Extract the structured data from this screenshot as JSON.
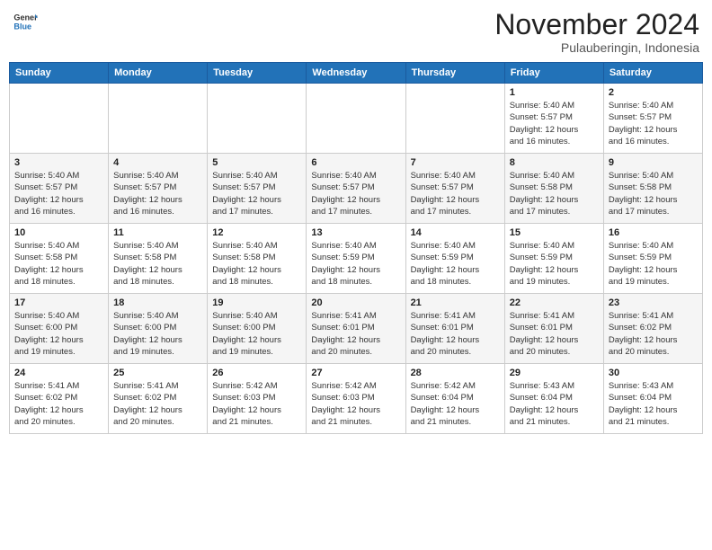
{
  "header": {
    "logo_general": "General",
    "logo_blue": "Blue",
    "month": "November 2024",
    "location": "Pulauberingin, Indonesia"
  },
  "weekdays": [
    "Sunday",
    "Monday",
    "Tuesday",
    "Wednesday",
    "Thursday",
    "Friday",
    "Saturday"
  ],
  "weeks": [
    [
      {
        "day": "",
        "info": ""
      },
      {
        "day": "",
        "info": ""
      },
      {
        "day": "",
        "info": ""
      },
      {
        "day": "",
        "info": ""
      },
      {
        "day": "",
        "info": ""
      },
      {
        "day": "1",
        "info": "Sunrise: 5:40 AM\nSunset: 5:57 PM\nDaylight: 12 hours\nand 16 minutes."
      },
      {
        "day": "2",
        "info": "Sunrise: 5:40 AM\nSunset: 5:57 PM\nDaylight: 12 hours\nand 16 minutes."
      }
    ],
    [
      {
        "day": "3",
        "info": "Sunrise: 5:40 AM\nSunset: 5:57 PM\nDaylight: 12 hours\nand 16 minutes."
      },
      {
        "day": "4",
        "info": "Sunrise: 5:40 AM\nSunset: 5:57 PM\nDaylight: 12 hours\nand 16 minutes."
      },
      {
        "day": "5",
        "info": "Sunrise: 5:40 AM\nSunset: 5:57 PM\nDaylight: 12 hours\nand 17 minutes."
      },
      {
        "day": "6",
        "info": "Sunrise: 5:40 AM\nSunset: 5:57 PM\nDaylight: 12 hours\nand 17 minutes."
      },
      {
        "day": "7",
        "info": "Sunrise: 5:40 AM\nSunset: 5:57 PM\nDaylight: 12 hours\nand 17 minutes."
      },
      {
        "day": "8",
        "info": "Sunrise: 5:40 AM\nSunset: 5:58 PM\nDaylight: 12 hours\nand 17 minutes."
      },
      {
        "day": "9",
        "info": "Sunrise: 5:40 AM\nSunset: 5:58 PM\nDaylight: 12 hours\nand 17 minutes."
      }
    ],
    [
      {
        "day": "10",
        "info": "Sunrise: 5:40 AM\nSunset: 5:58 PM\nDaylight: 12 hours\nand 18 minutes."
      },
      {
        "day": "11",
        "info": "Sunrise: 5:40 AM\nSunset: 5:58 PM\nDaylight: 12 hours\nand 18 minutes."
      },
      {
        "day": "12",
        "info": "Sunrise: 5:40 AM\nSunset: 5:58 PM\nDaylight: 12 hours\nand 18 minutes."
      },
      {
        "day": "13",
        "info": "Sunrise: 5:40 AM\nSunset: 5:59 PM\nDaylight: 12 hours\nand 18 minutes."
      },
      {
        "day": "14",
        "info": "Sunrise: 5:40 AM\nSunset: 5:59 PM\nDaylight: 12 hours\nand 18 minutes."
      },
      {
        "day": "15",
        "info": "Sunrise: 5:40 AM\nSunset: 5:59 PM\nDaylight: 12 hours\nand 19 minutes."
      },
      {
        "day": "16",
        "info": "Sunrise: 5:40 AM\nSunset: 5:59 PM\nDaylight: 12 hours\nand 19 minutes."
      }
    ],
    [
      {
        "day": "17",
        "info": "Sunrise: 5:40 AM\nSunset: 6:00 PM\nDaylight: 12 hours\nand 19 minutes."
      },
      {
        "day": "18",
        "info": "Sunrise: 5:40 AM\nSunset: 6:00 PM\nDaylight: 12 hours\nand 19 minutes."
      },
      {
        "day": "19",
        "info": "Sunrise: 5:40 AM\nSunset: 6:00 PM\nDaylight: 12 hours\nand 19 minutes."
      },
      {
        "day": "20",
        "info": "Sunrise: 5:41 AM\nSunset: 6:01 PM\nDaylight: 12 hours\nand 20 minutes."
      },
      {
        "day": "21",
        "info": "Sunrise: 5:41 AM\nSunset: 6:01 PM\nDaylight: 12 hours\nand 20 minutes."
      },
      {
        "day": "22",
        "info": "Sunrise: 5:41 AM\nSunset: 6:01 PM\nDaylight: 12 hours\nand 20 minutes."
      },
      {
        "day": "23",
        "info": "Sunrise: 5:41 AM\nSunset: 6:02 PM\nDaylight: 12 hours\nand 20 minutes."
      }
    ],
    [
      {
        "day": "24",
        "info": "Sunrise: 5:41 AM\nSunset: 6:02 PM\nDaylight: 12 hours\nand 20 minutes."
      },
      {
        "day": "25",
        "info": "Sunrise: 5:41 AM\nSunset: 6:02 PM\nDaylight: 12 hours\nand 20 minutes."
      },
      {
        "day": "26",
        "info": "Sunrise: 5:42 AM\nSunset: 6:03 PM\nDaylight: 12 hours\nand 21 minutes."
      },
      {
        "day": "27",
        "info": "Sunrise: 5:42 AM\nSunset: 6:03 PM\nDaylight: 12 hours\nand 21 minutes."
      },
      {
        "day": "28",
        "info": "Sunrise: 5:42 AM\nSunset: 6:04 PM\nDaylight: 12 hours\nand 21 minutes."
      },
      {
        "day": "29",
        "info": "Sunrise: 5:43 AM\nSunset: 6:04 PM\nDaylight: 12 hours\nand 21 minutes."
      },
      {
        "day": "30",
        "info": "Sunrise: 5:43 AM\nSunset: 6:04 PM\nDaylight: 12 hours\nand 21 minutes."
      }
    ]
  ]
}
